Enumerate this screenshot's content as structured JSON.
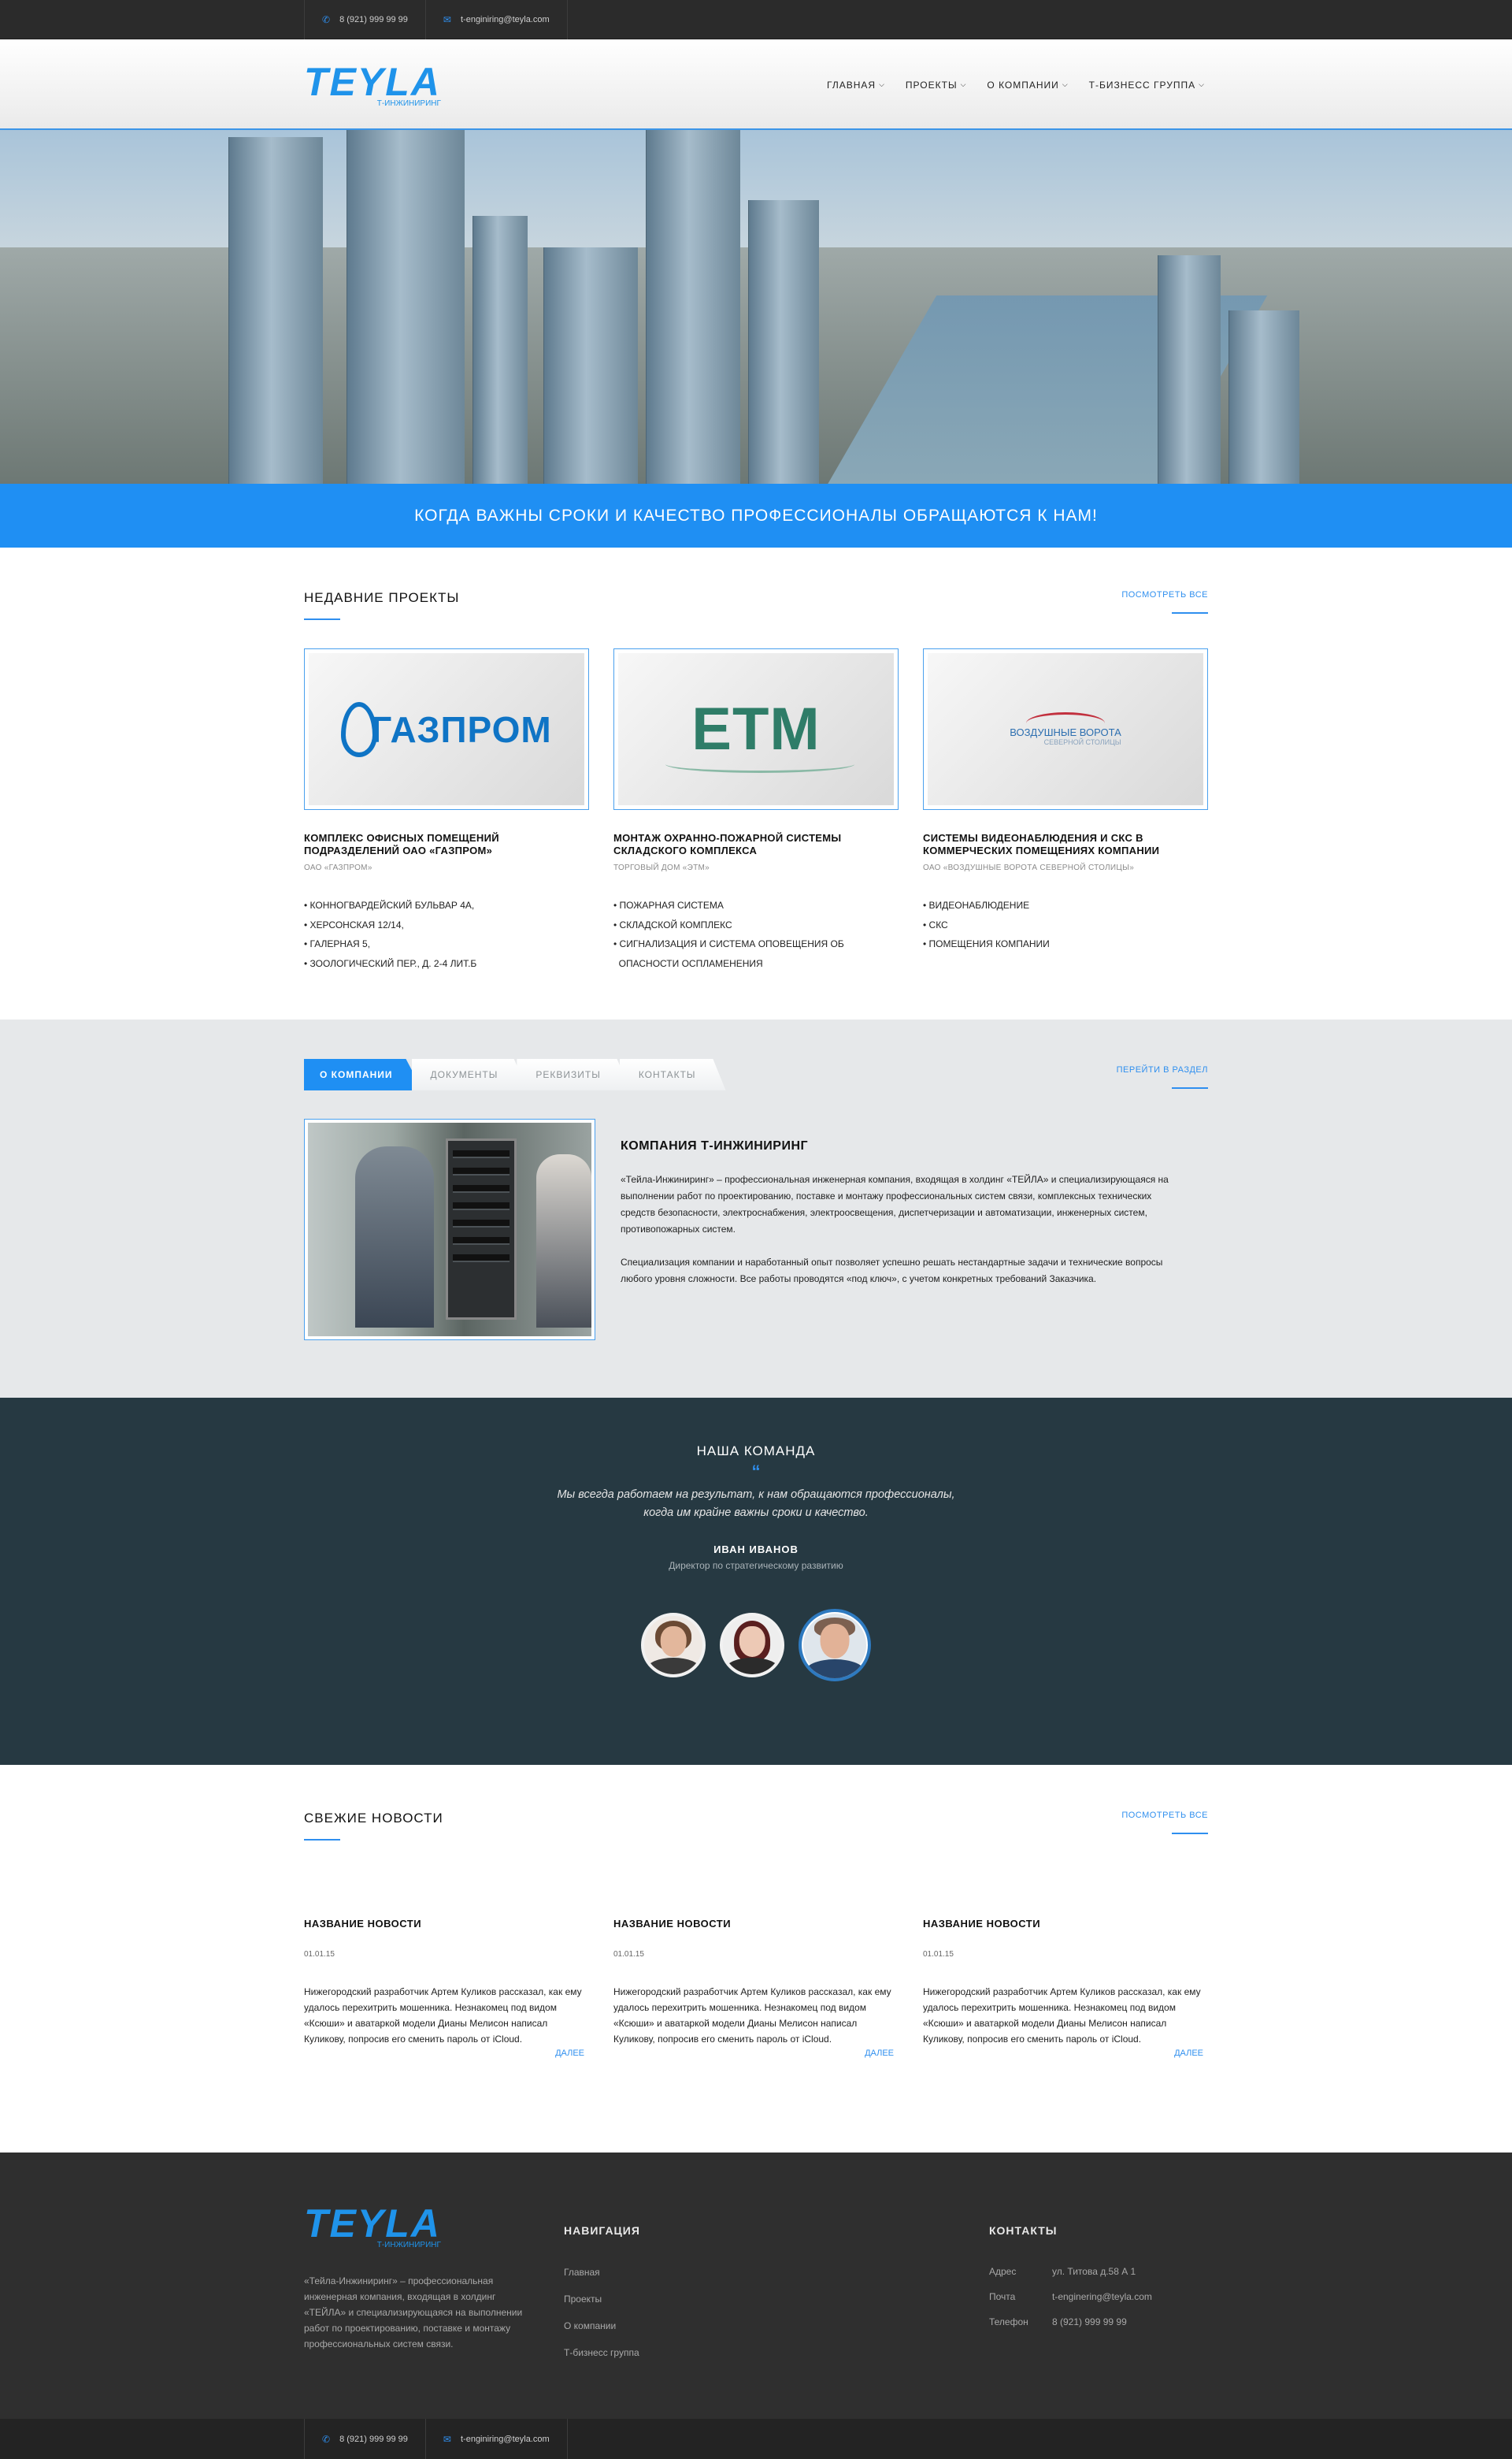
{
  "topbar": {
    "phone": "8 (921) 999 99 99",
    "email": "t-enginiring@teyla.com"
  },
  "header": {
    "logo": "TEYLA",
    "logo_sub": "Т-ИНЖИНИРИНГ",
    "nav": [
      "ГЛАВНАЯ",
      "ПРОЕКТЫ",
      "О КОМПАНИИ",
      "Т-БИЗНЕСС ГРУППА"
    ]
  },
  "hero": {
    "tagline": "КОГДА ВАЖНЫ СРОКИ И КАЧЕСТВО ПРОФЕССИОНАЛЫ ОБРАЩАЮТСЯ К НАМ!"
  },
  "projects": {
    "title": "НЕДАВНИЕ ПРОЕКТЫ",
    "link": "ПОСМОТРЕТЬ ВСЕ",
    "items": [
      {
        "logo": "ГАЗПРОМ",
        "title": "КОМПЛЕКС ОФИСНЫХ ПОМЕЩЕНИЙ ПОДРАЗДЕЛЕНИЙ ОАО «ГАЗПРОМ»",
        "subtitle": "ОАО «ГАЗПРОМ»",
        "list": [
          "• КОННОГВАРДЕЙСКИЙ БУЛЬВАР 4А,",
          "• ХЕРСОНСКАЯ 12/14,",
          "• ГАЛЕРНАЯ 5,",
          "• ЗООЛОГИЧЕСКИЙ ПЕР., Д. 2-4 ЛИТ.Б"
        ]
      },
      {
        "logo": "ETM",
        "title": "МОНТАЖ ОХРАННО-ПОЖАРНОЙ СИСТЕМЫ СКЛАДСКОГО КОМПЛЕКСА",
        "subtitle": "ТОРГОВЫЙ ДОМ «ЭТМ»",
        "list": [
          "• ПОЖАРНАЯ СИСТЕМА",
          "• СКЛАДСКОЙ КОМПЛЕКС",
          "• СИГНАЛИЗАЦИЯ И СИСТЕМА ОПОВЕЩЕНИЯ ОБ",
          "  ОПАСНОСТИ ОСПЛАМЕНЕНИЯ"
        ]
      },
      {
        "logo": "ВОЗДУШНЫЕ ВОРОТА",
        "logo_sub": "СЕВЕРНОЙ СТОЛИЦЫ",
        "title": "СИСТЕМЫ ВИДЕОНАБЛЮДЕНИЯ И СКС В КОММЕРЧЕСКИХ ПОМЕЩЕНИЯХ КОМПАНИИ",
        "subtitle": "ОАО «ВОЗДУШНЫЕ ВОРОТА СЕВЕРНОЙ СТОЛИЦЫ»",
        "list": [
          "• ВИДЕОНАБЛЮДЕНИЕ",
          "• СКС",
          "• ПОМЕЩЕНИЯ КОМПАНИИ"
        ]
      }
    ]
  },
  "company": {
    "tabs": [
      "О КОМПАНИИ",
      "ДОКУМЕНТЫ",
      "РЕКВИЗИТЫ",
      "КОНТАКТЫ"
    ],
    "link": "ПЕРЕЙТИ В РАЗДЕЛ",
    "title": "КОМПАНИЯ Т-ИНЖИНИРИНГ",
    "p1": "«Тейла-Инжиниринг» – профессиональная инженерная компания, входящая в холдинг «ТЕЙЛА» и специализирующаяся на выполнении работ по проектированию, поставке и монтажу профессиональных систем связи, комплексных технических средств безопасности, электроснабжения, электроосвещения, диспетчеризации и автоматизации, инженерных систем, противопожарных систем.",
    "p2": "Специализация компании и наработанный опыт позволяет успешно решать нестандартные задачи и технические вопросы любого уровня сложности. Все работы проводятся «под ключ», с учетом конкретных требований Заказчика."
  },
  "team": {
    "title": "НАША КОМАНДА",
    "quote_mark": "“",
    "quote_line1": "Мы всегда работаем на результат, к нам обращаются профессионалы,",
    "quote_line2": "когда им крайне важны сроки и качество.",
    "name": "ИВАН ИВАНОВ",
    "role": "Директор по стратегическому развитию"
  },
  "news": {
    "title": "СВЕЖИЕ НОВОСТИ",
    "link": "ПОСМОТРЕТЬ ВСЕ",
    "items": [
      {
        "title": "НАЗВАНИЕ НОВОСТИ",
        "date": "01.01.15",
        "text": "Нижегородский разработчик Артем Куликов рассказал, как ему удалось перехитрить мошенника. Незнакомец под видом «Ксюши» и аватаркой модели Дианы Мелисон написал Куликову, попросив его сменить пароль от iCloud.",
        "more": "ДАЛЕЕ"
      },
      {
        "title": "НАЗВАНИЕ НОВОСТИ",
        "date": "01.01.15",
        "text": "Нижегородский разработчик Артем Куликов рассказал, как ему удалось перехитрить мошенника. Незнакомец под видом «Ксюши» и аватаркой модели Дианы Мелисон написал Куликову, попросив его сменить пароль от iCloud.",
        "more": "ДАЛЕЕ"
      },
      {
        "title": "НАЗВАНИЕ НОВОСТИ",
        "date": "01.01.15",
        "text": "Нижегородский разработчик Артем Куликов рассказал, как ему удалось перехитрить мошенника. Незнакомец под видом «Ксюши» и аватаркой модели Дианы Мелисон написал Куликову, попросив его сменить пароль от iCloud.",
        "more": "ДАЛЕЕ"
      }
    ]
  },
  "footer": {
    "about": "«Тейла-Инжиниринг» – профессиональная инженерная компания, входящая в холдинг «ТЕЙЛА» и специализирующаяся на выполнении работ по проектированию, поставке и монтажу профессиональных систем связи.",
    "nav_title": "НАВИГАЦИЯ",
    "nav": [
      "Главная",
      "Проекты",
      "О компании",
      "Т-бизнесс группа"
    ],
    "contacts_title": "КОНТАКТЫ",
    "contacts": [
      {
        "label": "Адрес",
        "value": "ул. Титова д.58 А 1"
      },
      {
        "label": "Почта",
        "value": "t-enginering@teyla.com"
      },
      {
        "label": "Телефон",
        "value": "8 (921) 999 99 99"
      }
    ]
  },
  "colors": {
    "accent": "#1f8ff3",
    "dark": "#263942",
    "footer": "#2f2f2f"
  }
}
